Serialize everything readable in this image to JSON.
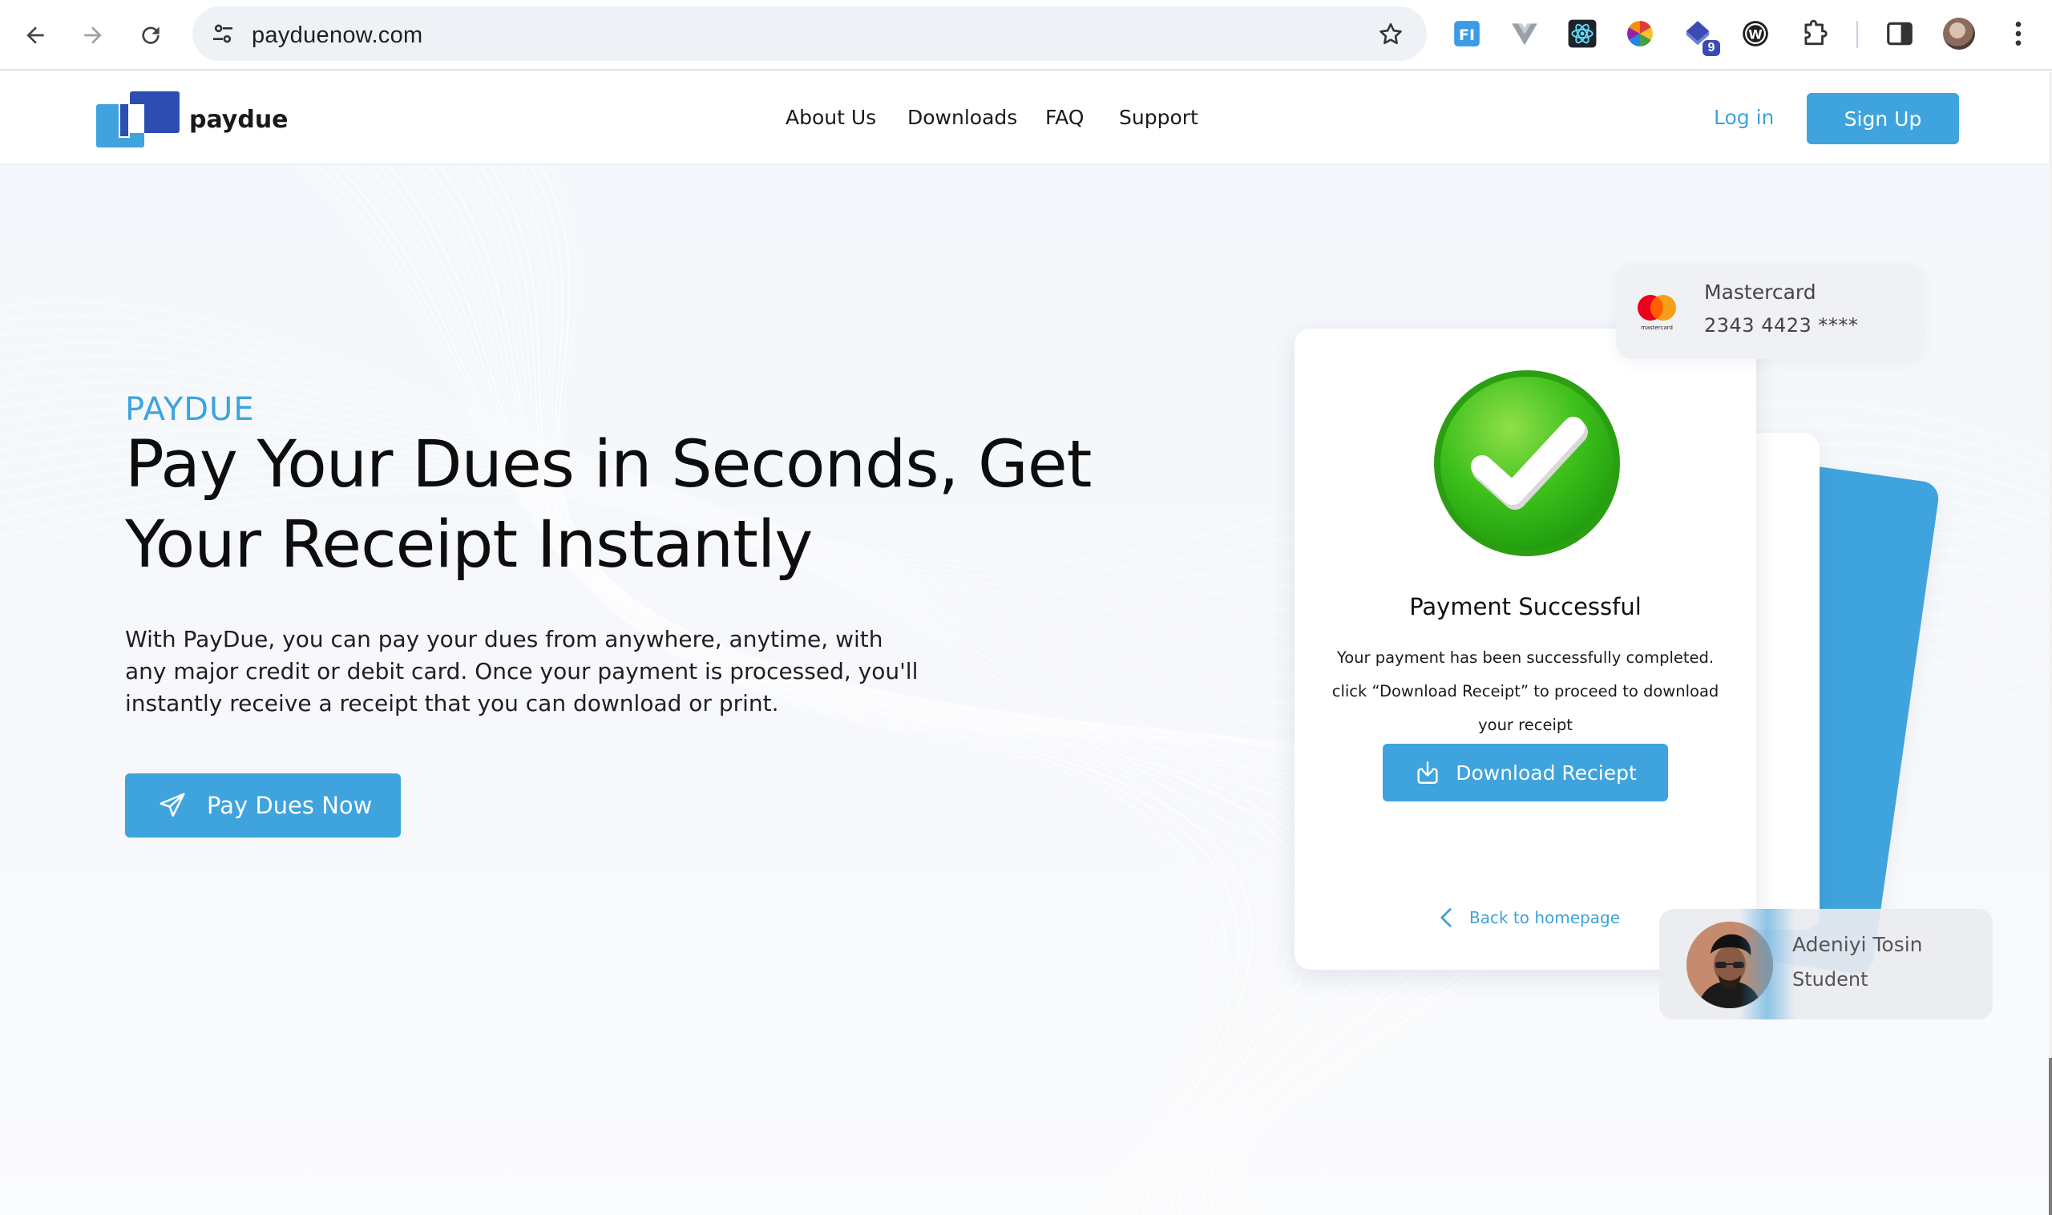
{
  "browser": {
    "url": "payduenow.com",
    "extension_badge": "9",
    "icons": [
      "back-arrow-icon",
      "forward-arrow-icon",
      "reload-icon",
      "site-settings-icon",
      "bookmark-star-icon",
      "fi-extension-icon",
      "vue-devtools-icon",
      "react-devtools-icon",
      "color-picker-icon",
      "extension-badge-icon",
      "wordpress-icon",
      "extensions-puzzle-icon",
      "side-panel-icon",
      "profile-avatar",
      "kebab-menu-icon"
    ]
  },
  "site": {
    "brand": "paydue",
    "nav": [
      {
        "label": "About Us"
      },
      {
        "label": "Downloads"
      },
      {
        "label": "FAQ"
      },
      {
        "label": "Support"
      }
    ],
    "login": "Log in",
    "signup": "Sign Up"
  },
  "hero": {
    "eyebrow": "PAYDUE",
    "headline": "Pay Your Dues in Seconds, Get Your Receipt Instantly",
    "lead": "With PayDue, you can pay your dues from anywhere, anytime, with any major credit or debit card. Once your payment is processed, you'll instantly receive a receipt that you can download or print.",
    "cta": "Pay Dues Now"
  },
  "payment_card": {
    "title": "Payment Successful",
    "body": "Your payment has been successfully completed. click “Download Receipt” to proceed to download your receipt",
    "button": "Download Reciept",
    "back_link": "Back to homepage"
  },
  "mastercard": {
    "brand_name": "Mastercard",
    "number": "2343 4423 ****",
    "logo_text": "mastercard"
  },
  "user": {
    "name": "Adeniyi Tosin",
    "role": "Student"
  },
  "colors": {
    "accent": "#3fa3dd",
    "success": "#2fae16",
    "logo_dark": "#2d4db3"
  }
}
